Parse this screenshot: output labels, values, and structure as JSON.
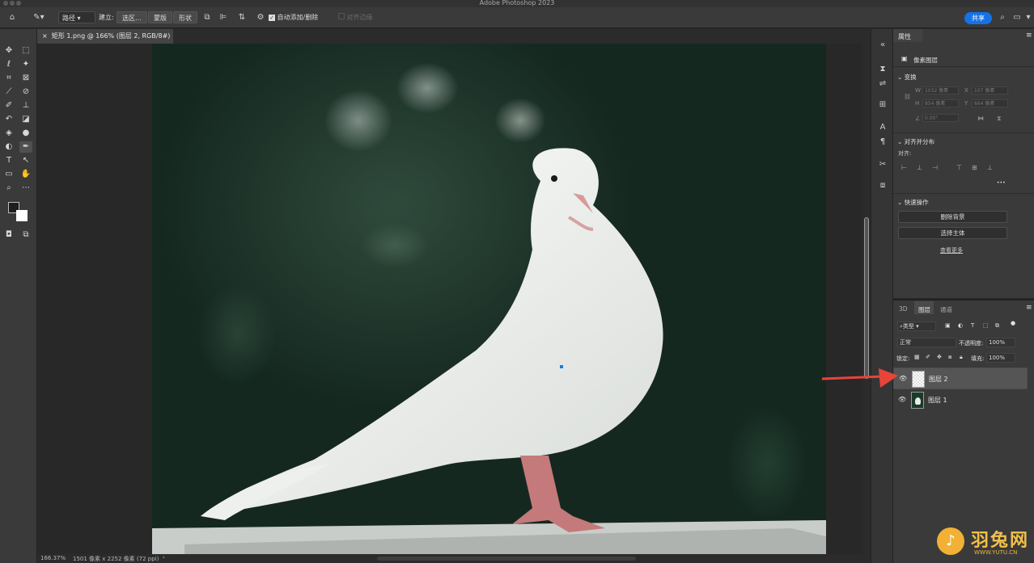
{
  "app": {
    "title": "Adobe Photoshop 2023"
  },
  "options_bar": {
    "mode": "路径",
    "make_label": "建立:",
    "selection_btn": "选区...",
    "mask_btn": "蒙版",
    "shape_btn": "形状",
    "auto_add_delete": "自动添加/删除",
    "align_edges": "对齐边缘",
    "share": "共享"
  },
  "document": {
    "tab_title": "矩形 1.png @ 166% (图层 2, RGB/8#) *",
    "zoom": "166.37%",
    "dimensions": "1501 像素 x 2252 像素 (72 ppi)"
  },
  "properties": {
    "panel_title": "属性",
    "layer_type": "像素图层",
    "transform_title": "变换",
    "w_label": "W",
    "w_value": "1032 像素",
    "x_label": "X",
    "x_value": "107 像素",
    "h_label": "H",
    "h_value": "854 像素",
    "y_label": "Y",
    "y_value": "664 像素",
    "angle_value": "0.00°",
    "align_title": "对齐并分布",
    "align_label": "对齐:",
    "more_dots": "•••",
    "quick_title": "快速操作",
    "remove_bg": "删除背景",
    "select_subject": "选择主体",
    "view_more": "查看更多"
  },
  "layers_panel": {
    "tabs": [
      "3D",
      "图层",
      "通道"
    ],
    "filter": "类型",
    "blend_mode": "正常",
    "opacity_label": "不透明度:",
    "opacity_value": "100%",
    "lock_label": "锁定:",
    "fill_label": "填充:",
    "fill_value": "100%",
    "layers": [
      {
        "name": "图层 2",
        "selected": true
      },
      {
        "name": "图层 1",
        "selected": false
      }
    ]
  },
  "watermark": {
    "cn": "羽兔网",
    "url": "WWW.YUTU.CN"
  },
  "colors": {
    "accent": "#1473e6",
    "arrow": "#e8443a"
  }
}
